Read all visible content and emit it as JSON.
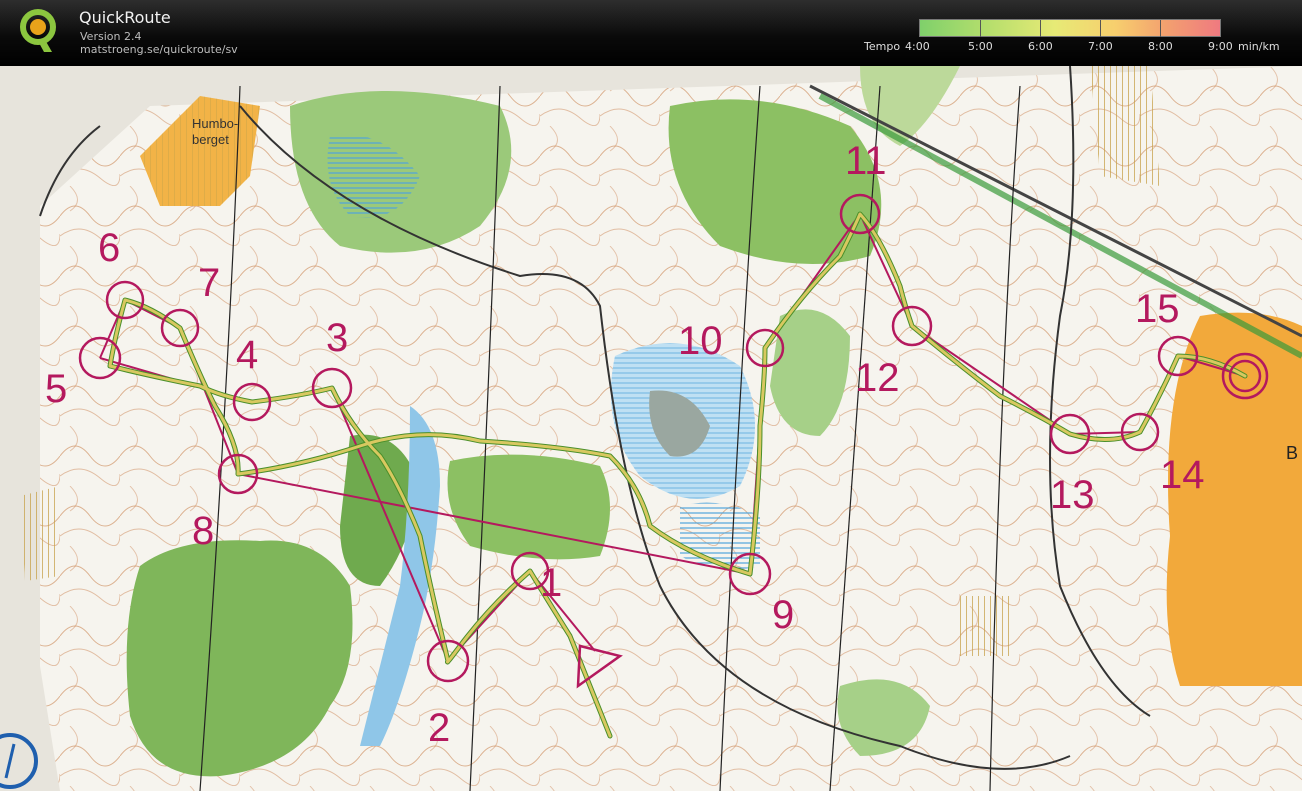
{
  "app": {
    "title": "QuickRoute",
    "version": "Version 2.4",
    "url": "matstroeng.se/quickroute/sv"
  },
  "tempo_scale": {
    "prefix": "Tempo",
    "labels": [
      "4:00",
      "5:00",
      "6:00",
      "7:00",
      "8:00",
      "9:00"
    ],
    "unit": "min/km",
    "colors": [
      "#7fd06b",
      "#b4de6c",
      "#e7ea76",
      "#f7cf6e",
      "#f3a06f",
      "#ef7a80"
    ]
  },
  "map": {
    "place_name": [
      "Humbo-",
      "berget"
    ],
    "edge_letter": "B",
    "controls": [
      "1",
      "2",
      "3",
      "4",
      "5",
      "6",
      "7",
      "8",
      "9",
      "10",
      "11",
      "12",
      "13",
      "14",
      "15"
    ],
    "colors": {
      "paper": "#f6f4ee",
      "forest_green": "#7fb65a",
      "light_green": "#bcd99a",
      "water_blue": "#8fc6e8",
      "open_yellow": "#f2b347",
      "control_magenta": "#b4195e",
      "contour_brown": "#b5652e",
      "route_line": "#c9c04a"
    }
  }
}
